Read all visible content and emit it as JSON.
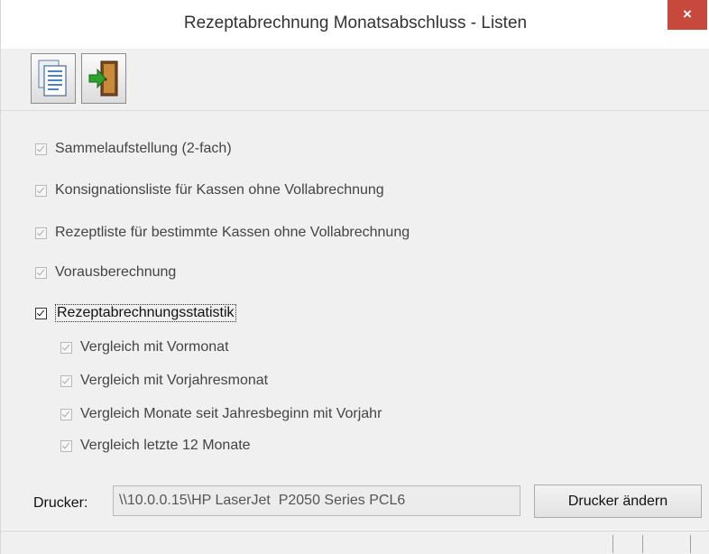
{
  "window": {
    "title": "Rezeptabrechnung Monatsabschluss - Listen",
    "close_label": "×"
  },
  "toolbar": {
    "buttons": [
      {
        "icon": "document-list-icon",
        "tooltip": ""
      },
      {
        "icon": "exit-door-icon",
        "tooltip": ""
      }
    ]
  },
  "checkboxes": [
    {
      "label": "Sammelaufstellung (2-fach)",
      "checked": true,
      "enabled": false
    },
    {
      "label": "Konsignationsliste für Kassen ohne Vollabrechnung",
      "checked": true,
      "enabled": false
    },
    {
      "label": "Rezeptliste für bestimmte Kassen ohne Vollabrechnung",
      "checked": true,
      "enabled": false
    },
    {
      "label": "Vorausberechnung",
      "checked": true,
      "enabled": false
    },
    {
      "label": "Rezeptabrechnungsstatistik",
      "checked": true,
      "enabled": true,
      "focused": true
    }
  ],
  "sub_checkboxes": [
    {
      "label": "Vergleich mit Vormonat",
      "checked": true,
      "enabled": false
    },
    {
      "label": "Vergleich mit Vorjahresmonat",
      "checked": true,
      "enabled": false
    },
    {
      "label": "Vergleich Monate seit Jahresbeginn mit Vorjahr",
      "checked": true,
      "enabled": false
    },
    {
      "label": "Vergleich letzte 12 Monate",
      "checked": true,
      "enabled": false
    }
  ],
  "printer": {
    "label": "Drucker:",
    "value": "\\\\10.0.0.15\\HP LaserJet  P2050 Series PCL6",
    "change_button": "Drucker ändern"
  },
  "colors": {
    "close_button": "#c7483c",
    "panel_background": "#f0f0f0"
  }
}
